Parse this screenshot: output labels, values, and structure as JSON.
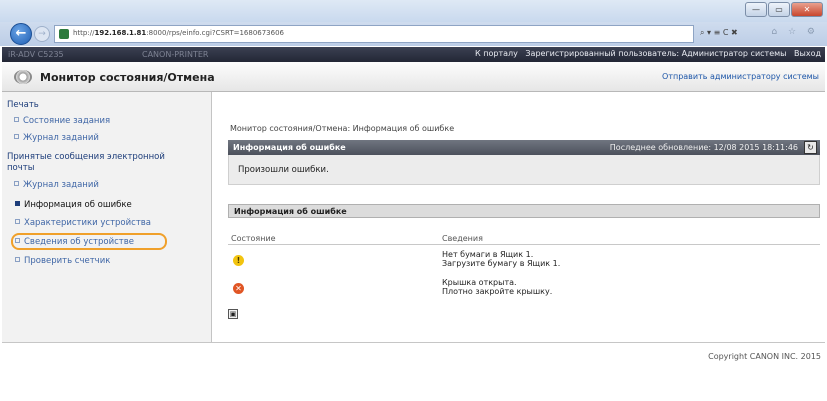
{
  "browser": {
    "url_prefix": "http://",
    "url_host": "192.168.1.81",
    "url_rest": ":8000/rps/einfo.cgi?CSRT=1680673606",
    "tools": "⌕ ▾ ≡ C ✖",
    "fav": "⌂ ☆ ⚙",
    "win": [
      "—",
      "▭",
      "✕"
    ]
  },
  "topbar": {
    "left1": "iR-ADV C5235",
    "left2": "CANON-PRINTER",
    "to_portal": "К порталу",
    "user": "Зарегистрированный пользователь: Администратор системы",
    "logout": "Выход"
  },
  "header": {
    "title": "Монитор состояния/Отмена",
    "send_admin": "Отправить администратору системы"
  },
  "sidebar": {
    "print": "Печать",
    "job_status": "Состояние задания",
    "job_log": "Журнал заданий",
    "email_rx_line1": "Принятые сообщения электронной",
    "email_rx_line2": "почты",
    "email_job_log": "Журнал заданий",
    "error_info": "Информация об ошибке",
    "device_features": "Характеристики устройства",
    "device_info": "Сведения об устройстве",
    "check_counter": "Проверить счетчик"
  },
  "main": {
    "breadcrumb": "Монитор состояния/Отмена: Информация об ошибке",
    "section_title": "Информация об ошибке",
    "last_update": "Последнее обновление: 12/08 2015 18:11:46",
    "error_message": "Произошли ошибки.",
    "subsection_title": "Информация об ошибке",
    "col_status": "Состояние",
    "col_details": "Сведения",
    "rows": [
      {
        "icon": "warning-icon",
        "line1": "Нет бумаги в Ящик 1.",
        "line2": "Загрузите бумагу в Ящик 1."
      },
      {
        "icon": "error-icon",
        "line1": "Крышка открыта.",
        "line2": "Плотно закройте крышку."
      }
    ]
  },
  "footer": {
    "copyright": "Copyright CANON INC. 2015"
  }
}
